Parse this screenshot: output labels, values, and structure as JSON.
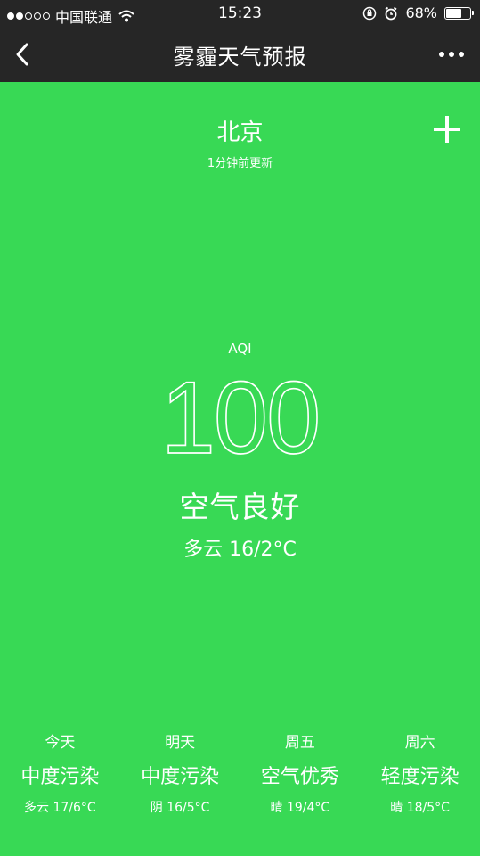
{
  "status_bar": {
    "carrier": "中国联通",
    "time": "15:23",
    "battery": "68%",
    "battery_level": 0.68
  },
  "nav": {
    "title": "雾霾天气预报"
  },
  "location": {
    "city": "北京",
    "updated": "1分钟前更新"
  },
  "aqi": {
    "label": "AQI",
    "value": "100",
    "quality": "空气良好",
    "weather": "多云 16/2°C"
  },
  "forecast": [
    {
      "day": "今天",
      "quality": "中度污染",
      "weather": "多云 17/6°C"
    },
    {
      "day": "明天",
      "quality": "中度污染",
      "weather": "阴 16/5°C"
    },
    {
      "day": "周五",
      "quality": "空气优秀",
      "weather": "晴 19/4°C"
    },
    {
      "day": "周六",
      "quality": "轻度污染",
      "weather": "晴 18/5°C"
    }
  ],
  "colors": {
    "background": "#38d955",
    "bar": "#262626",
    "text": "#ffffff"
  }
}
